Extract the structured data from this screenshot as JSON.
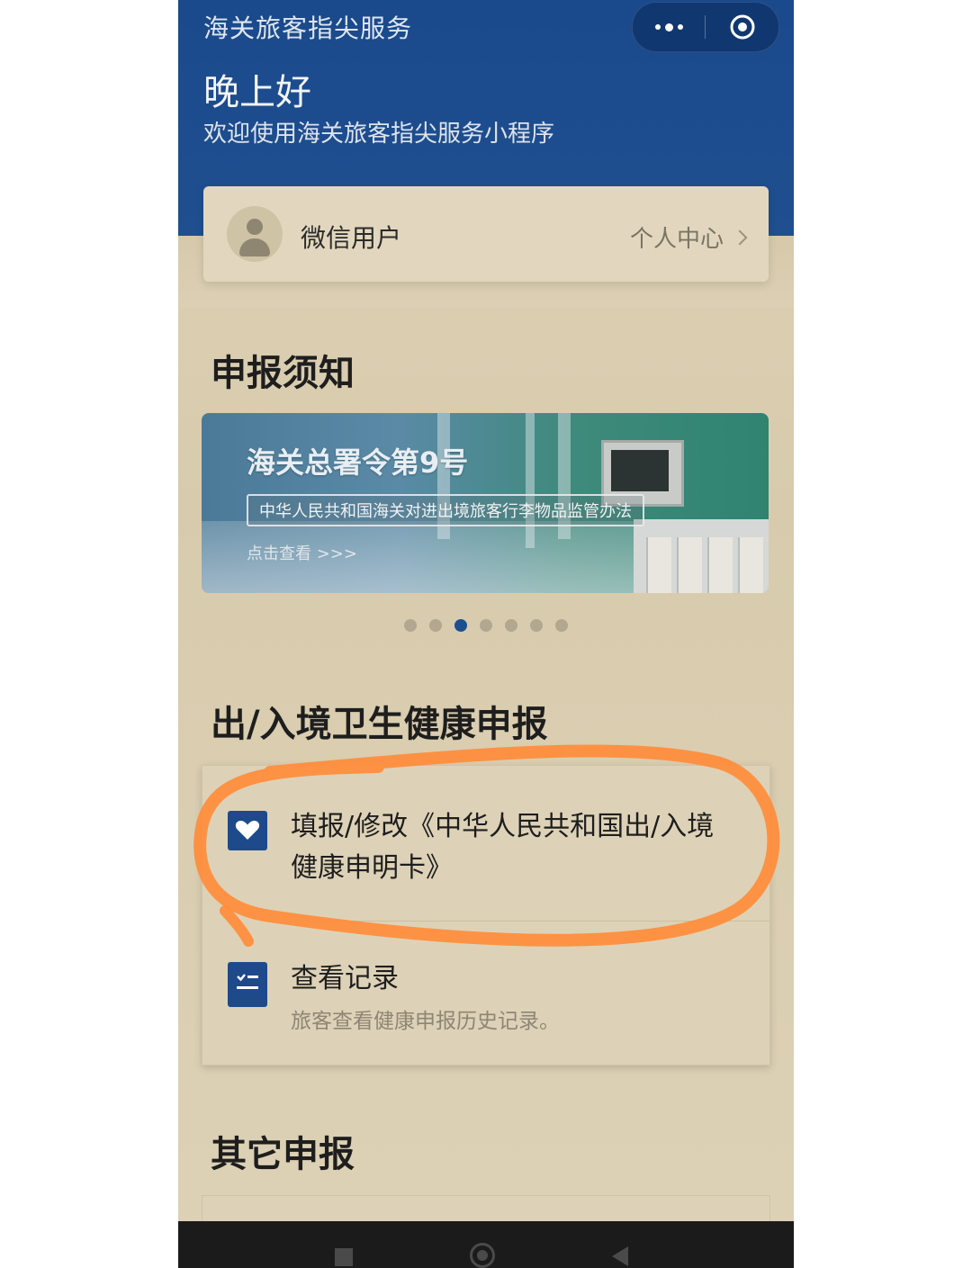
{
  "app": {
    "title": "海关旅客指尖服务",
    "greeting": "晚上好",
    "welcome": "欢迎使用海关旅客指尖服务小程序"
  },
  "capsule": {
    "more_icon": "more-dots-icon",
    "close_icon": "target-circle-icon"
  },
  "user": {
    "name": "微信用户",
    "personal_center": "个人中心",
    "avatar_icon": "user-avatar-icon"
  },
  "sections": {
    "notice": "申报须知",
    "health": "出/入境卫生健康申报",
    "other": "其它申报"
  },
  "banner": {
    "title": "海关总署令第9号",
    "subtitle": "中华人民共和国海关对进出境旅客行李物品监管办法",
    "link": "点击查看 >>>",
    "dots_count": 7,
    "active_dot": 3
  },
  "health_items": [
    {
      "title": "填报/修改《中华人民共和国出/入境健康申明卡》",
      "icon": "heart-icon"
    },
    {
      "title": "查看记录",
      "desc": "旅客查看健康申报历史记录。",
      "icon": "record-list-icon"
    }
  ],
  "colors": {
    "header_blue": "#1a4a8c",
    "page_bg": "#d9cdb2",
    "accent": "#1e4a8c",
    "annotation": "#ff8c3a"
  }
}
